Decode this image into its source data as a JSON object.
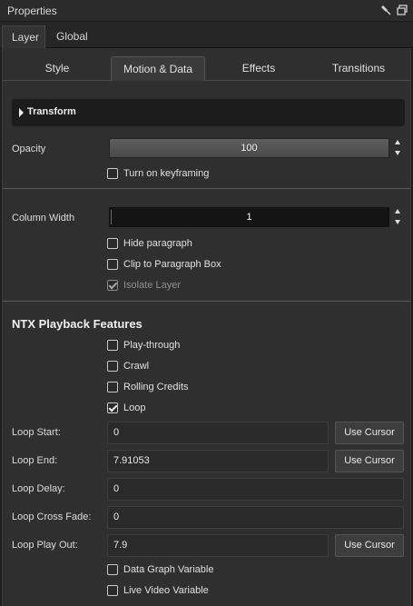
{
  "window": {
    "title": "Properties"
  },
  "top_tabs": [
    {
      "label": "Layer",
      "active": true
    },
    {
      "label": "Global",
      "active": false
    }
  ],
  "sub_tabs": [
    {
      "label": "Style",
      "active": false
    },
    {
      "label": "Motion & Data",
      "active": true
    },
    {
      "label": "Effects",
      "active": false
    },
    {
      "label": "Transitions",
      "active": false
    }
  ],
  "transform": {
    "section_label": "Transform",
    "opacity": {
      "label": "Opacity",
      "value": "100"
    },
    "keyframing": {
      "label": "Turn on keyframing",
      "checked": false
    }
  },
  "column": {
    "width_label": "Column Width",
    "width_value": "1",
    "hide_paragraph": {
      "label": "Hide paragraph",
      "checked": false
    },
    "clip_to_box": {
      "label": "Clip to Paragraph Box",
      "checked": false
    },
    "isolate_layer": {
      "label": "Isolate Layer",
      "checked": true,
      "disabled": true
    }
  },
  "playback": {
    "heading": "NTX Playback Features",
    "play_through": {
      "label": "Play-through",
      "checked": false
    },
    "crawl": {
      "label": "Crawl",
      "checked": false
    },
    "rolling_credits": {
      "label": "Rolling Credits",
      "checked": false
    },
    "loop": {
      "label": "Loop",
      "checked": true
    },
    "loop_start": {
      "label": "Loop Start:",
      "value": "0"
    },
    "loop_end": {
      "label": "Loop End:",
      "value": "7.91053"
    },
    "loop_delay": {
      "label": "Loop Delay:",
      "value": "0"
    },
    "loop_cross_fade": {
      "label": "Loop Cross Fade:",
      "value": "0"
    },
    "loop_play_out": {
      "label": "Loop Play Out:",
      "value": "7.9"
    },
    "use_cursor_label": "Use Cursor",
    "data_graph_variable": {
      "label": "Data Graph Variable",
      "checked": false
    },
    "live_video_variable": {
      "label": "Live Video Variable",
      "checked": false
    }
  },
  "colors": {
    "background": "#2f2f2f",
    "panel_dark": "#1c1c1c",
    "text": "#dcdcdc"
  }
}
